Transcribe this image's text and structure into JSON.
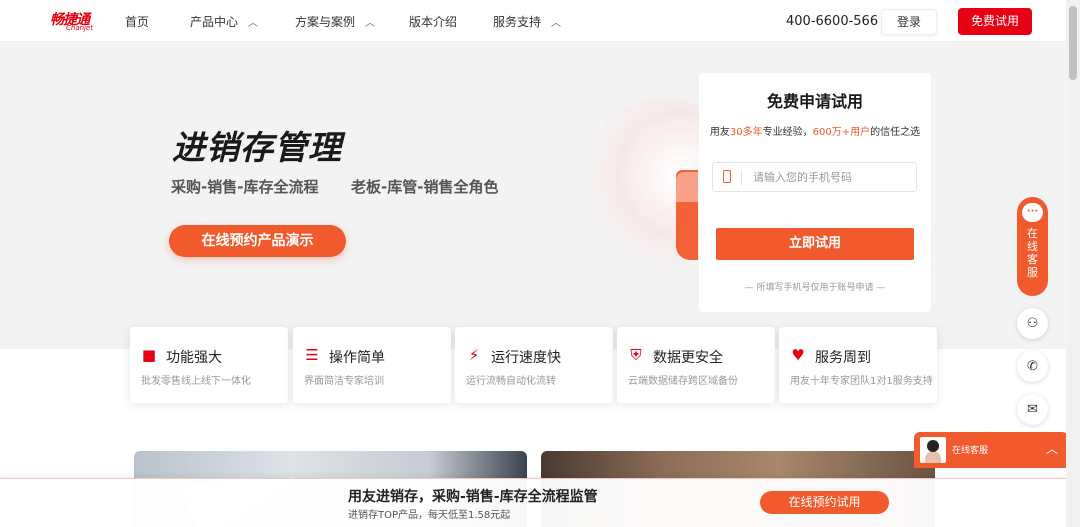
{
  "brand": {
    "name_cn": "畅捷通",
    "name_en": "Chanjet",
    "color": "#e60012"
  },
  "nav": {
    "items": [
      {
        "label": "首页"
      },
      {
        "label": "产品中心"
      },
      {
        "label": "方案与案例"
      },
      {
        "label": "版本介绍"
      },
      {
        "label": "服务支持"
      }
    ],
    "phone": "400-6600-566",
    "login_label": "登录",
    "trial_label": "免费试用"
  },
  "hero": {
    "title": "进销存管理",
    "subtitle_1": "采购-销售-库存全流程",
    "subtitle_2": "老板-库管-销售全角色",
    "cta_label": "在线预约产品演示",
    "accent": "#f05a2c"
  },
  "form": {
    "title": "免费申请试用",
    "sub_prefix": "用友",
    "sub_hl1": "30多年",
    "sub_mid": "专业经验，",
    "sub_hl2": "600万+用户",
    "sub_suffix": "的信任之选",
    "phone_placeholder": "请输入您的手机号码",
    "phone_value": "",
    "submit_label": "立即试用",
    "note": "— 所填写手机号仅用于账号申请 —"
  },
  "features": [
    {
      "icon": "grid-icon",
      "title": "功能强大",
      "desc": "批发零售线上线下一体化"
    },
    {
      "icon": "sliders-icon",
      "title": "操作简单",
      "desc": "界面简洁专家培训"
    },
    {
      "icon": "lightning-icon",
      "title": "运行速度快",
      "desc": "运行流畅自动化流转"
    },
    {
      "icon": "shield-icon",
      "title": "数据更安全",
      "desc": "云端数据储存跨区域备份"
    },
    {
      "icon": "heart-hand-icon",
      "title": "服务周到",
      "desc": "用友十年专家团队1对1服务支持"
    }
  ],
  "side": {
    "cs_label": "在线客服",
    "chat_title": "在线客服"
  },
  "bottom": {
    "title": "用友进销存，采购-销售-库存全流程监管",
    "subtitle": "进销存TOP产品，每天低至1.58元起",
    "cta_label": "在线预约试用"
  }
}
